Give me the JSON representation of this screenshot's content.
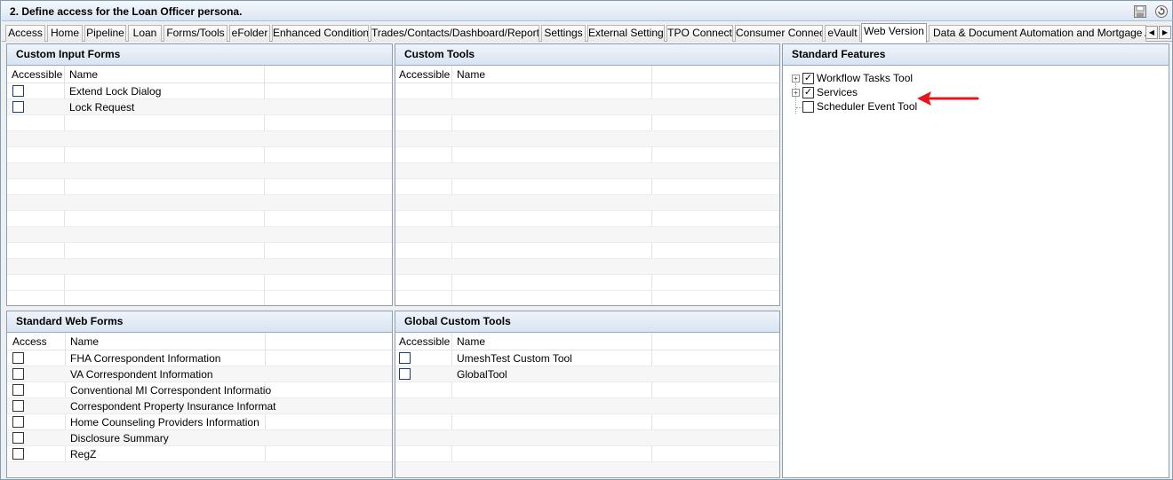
{
  "window": {
    "title": "2. Define access for the Loan Officer persona."
  },
  "icons": {
    "save": "save-disk-icon",
    "reset": "reset-icon"
  },
  "tabs": [
    {
      "label": "Access"
    },
    {
      "label": "Home"
    },
    {
      "label": "Pipeline"
    },
    {
      "label": "Loan"
    },
    {
      "label": "Forms/Tools"
    },
    {
      "label": "eFolder"
    },
    {
      "label": "Enhanced Conditions"
    },
    {
      "label": "Trades/Contacts/Dashboard/Reports"
    },
    {
      "label": "Settings"
    },
    {
      "label": "External Settings"
    },
    {
      "label": "TPO Connect"
    },
    {
      "label": "Consumer Connect"
    },
    {
      "label": "eVault"
    },
    {
      "label": "Web Version"
    },
    {
      "label": "Data & Document Automation and Mortgage Analyzers"
    }
  ],
  "active_tab": "Web Version",
  "custom_input_forms": {
    "title": "Custom Input Forms",
    "col_accessible": "Accessible",
    "col_name": "Name",
    "rows": [
      {
        "name": "Extend Lock Dialog"
      },
      {
        "name": "Lock Request"
      }
    ]
  },
  "custom_tools": {
    "title": "Custom Tools",
    "col_accessible": "Accessible",
    "col_name": "Name"
  },
  "standard_features": {
    "title": "Standard Features",
    "items": [
      {
        "label": "Workflow Tasks Tool",
        "checked": true
      },
      {
        "label": "Services",
        "checked": true
      },
      {
        "label": "Scheduler Event Tool",
        "checked": false
      }
    ],
    "arrow_color": "#e8141b"
  },
  "standard_web_forms": {
    "title": "Standard Web Forms",
    "col_access": "Access",
    "col_name": "Name",
    "rows": [
      {
        "name": "FHA Correspondent Information"
      },
      {
        "name": "VA Correspondent Information"
      },
      {
        "name": "Conventional MI Correspondent Informatio"
      },
      {
        "name": "Correspondent Property Insurance Informat"
      },
      {
        "name": "Home Counseling Providers Information"
      },
      {
        "name": "Disclosure Summary"
      },
      {
        "name": "RegZ"
      }
    ]
  },
  "global_custom_tools": {
    "title": "Global Custom Tools",
    "col_accessible": "Accessible",
    "col_name": "Name",
    "rows": [
      {
        "name": "UmeshTest Custom Tool"
      },
      {
        "name": "GlobalTool"
      }
    ]
  }
}
